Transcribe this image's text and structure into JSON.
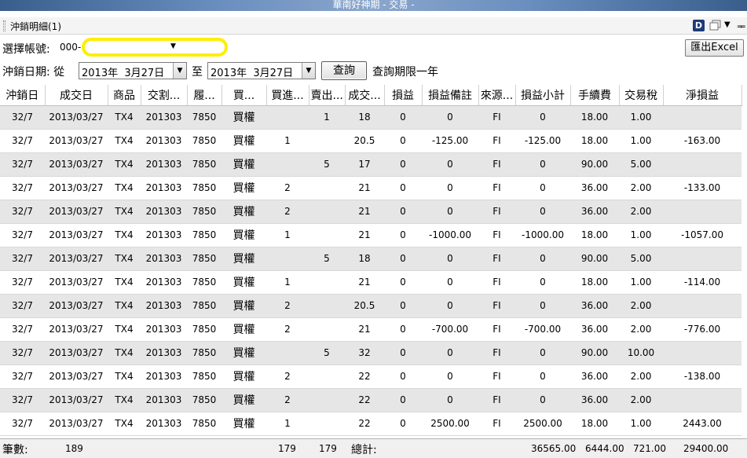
{
  "window": {
    "title": "華南好神期 - 交易 -"
  },
  "panel": {
    "title": "沖銷明細(1)",
    "d_icon": "D"
  },
  "account": {
    "label": "選擇帳號:",
    "prefix": "000-"
  },
  "excel_button": "匯出Excel",
  "date": {
    "label": "沖銷日期: 從",
    "from": "2013年  3月27日",
    "to_label": "至",
    "to": "2013年  3月27日",
    "query_button": "查詢",
    "limit_note": "查詢期限一年"
  },
  "table": {
    "headers": [
      "沖銷日",
      "成交日",
      "商品",
      "交割...",
      "履...",
      "買...",
      "買進...",
      "賣出...",
      "成交...",
      "損益",
      "損益備註",
      "來源...",
      "損益小計",
      "手續費",
      "交易稅",
      "淨損益"
    ],
    "rows": [
      [
        "32/7",
        "2013/03/27",
        "TX4",
        "201303",
        "7850",
        "買權",
        "",
        "1",
        "18",
        "0",
        "0",
        "FI",
        "0",
        "18.00",
        "1.00",
        ""
      ],
      [
        "32/7",
        "2013/03/27",
        "TX4",
        "201303",
        "7850",
        "買權",
        "1",
        "",
        "20.5",
        "0",
        "-125.00",
        "FI",
        "-125.00",
        "18.00",
        "1.00",
        "-163.00"
      ],
      [
        "32/7",
        "2013/03/27",
        "TX4",
        "201303",
        "7850",
        "買權",
        "",
        "5",
        "17",
        "0",
        "0",
        "FI",
        "0",
        "90.00",
        "5.00",
        ""
      ],
      [
        "32/7",
        "2013/03/27",
        "TX4",
        "201303",
        "7850",
        "買權",
        "2",
        "",
        "21",
        "0",
        "0",
        "FI",
        "0",
        "36.00",
        "2.00",
        "-133.00"
      ],
      [
        "32/7",
        "2013/03/27",
        "TX4",
        "201303",
        "7850",
        "買權",
        "2",
        "",
        "21",
        "0",
        "0",
        "FI",
        "0",
        "36.00",
        "2.00",
        ""
      ],
      [
        "32/7",
        "2013/03/27",
        "TX4",
        "201303",
        "7850",
        "買權",
        "1",
        "",
        "21",
        "0",
        "-1000.00",
        "FI",
        "-1000.00",
        "18.00",
        "1.00",
        "-1057.00"
      ],
      [
        "32/7",
        "2013/03/27",
        "TX4",
        "201303",
        "7850",
        "買權",
        "",
        "5",
        "18",
        "0",
        "0",
        "FI",
        "0",
        "90.00",
        "5.00",
        ""
      ],
      [
        "32/7",
        "2013/03/27",
        "TX4",
        "201303",
        "7850",
        "買權",
        "1",
        "",
        "21",
        "0",
        "0",
        "FI",
        "0",
        "18.00",
        "1.00",
        "-114.00"
      ],
      [
        "32/7",
        "2013/03/27",
        "TX4",
        "201303",
        "7850",
        "買權",
        "2",
        "",
        "20.5",
        "0",
        "0",
        "FI",
        "0",
        "36.00",
        "2.00",
        ""
      ],
      [
        "32/7",
        "2013/03/27",
        "TX4",
        "201303",
        "7850",
        "買權",
        "2",
        "",
        "21",
        "0",
        "-700.00",
        "FI",
        "-700.00",
        "36.00",
        "2.00",
        "-776.00"
      ],
      [
        "32/7",
        "2013/03/27",
        "TX4",
        "201303",
        "7850",
        "買權",
        "",
        "5",
        "32",
        "0",
        "0",
        "FI",
        "0",
        "90.00",
        "10.00",
        ""
      ],
      [
        "32/7",
        "2013/03/27",
        "TX4",
        "201303",
        "7850",
        "買權",
        "2",
        "",
        "22",
        "0",
        "0",
        "FI",
        "0",
        "36.00",
        "2.00",
        "-138.00"
      ],
      [
        "32/7",
        "2013/03/27",
        "TX4",
        "201303",
        "7850",
        "買權",
        "2",
        "",
        "22",
        "0",
        "0",
        "FI",
        "0",
        "36.00",
        "2.00",
        ""
      ],
      [
        "32/7",
        "2013/03/27",
        "TX4",
        "201303",
        "7850",
        "買權",
        "1",
        "",
        "22",
        "0",
        "2500.00",
        "FI",
        "2500.00",
        "18.00",
        "1.00",
        "2443.00"
      ]
    ]
  },
  "footer": {
    "count_label": "筆數:",
    "count": "189",
    "buy_total": "179",
    "sell_total": "179",
    "total_label": "總計:",
    "pl_subtotal": "36565.00",
    "fee_total": "6444.00",
    "tax_total": "721.00",
    "net_total": "29400.00"
  },
  "icons": [
    "grip-icon",
    "d-icon",
    "window-icon",
    "dropdown-icon",
    "pin-icon"
  ]
}
